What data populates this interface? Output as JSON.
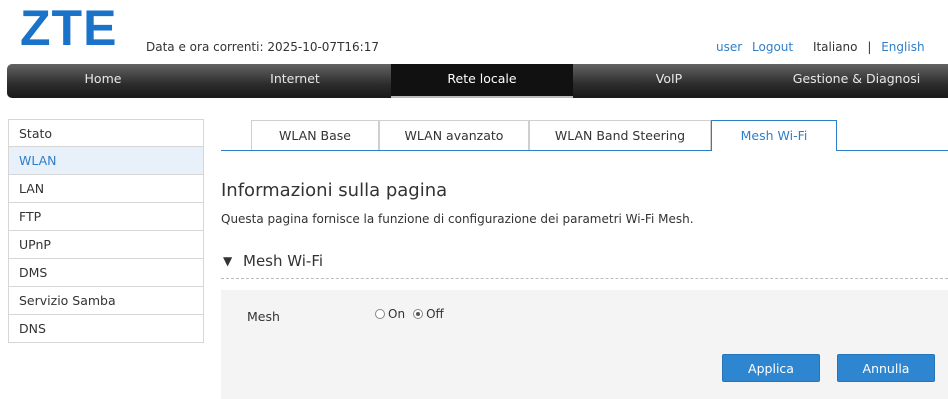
{
  "header": {
    "logo": "ZTE",
    "datetime": "Data e ora correnti: 2025-10-07T16:17",
    "user": "user",
    "logout": "Logout",
    "lang_it": "Italiano",
    "lang_sep": "|",
    "lang_en": "English"
  },
  "nav": {
    "items": [
      {
        "label": "Home",
        "active": false
      },
      {
        "label": "Internet",
        "active": false
      },
      {
        "label": "Rete locale",
        "active": true
      },
      {
        "label": "VoIP",
        "active": false
      },
      {
        "label": "Gestione & Diagnosi",
        "active": false
      }
    ]
  },
  "sidebar": {
    "items": [
      {
        "label": "Stato",
        "active": false
      },
      {
        "label": "WLAN",
        "active": true
      },
      {
        "label": "LAN",
        "active": false
      },
      {
        "label": "FTP",
        "active": false
      },
      {
        "label": "UPnP",
        "active": false
      },
      {
        "label": "DMS",
        "active": false
      },
      {
        "label": "Servizio Samba",
        "active": false
      },
      {
        "label": "DNS",
        "active": false
      }
    ]
  },
  "tabs": {
    "items": [
      {
        "label": "WLAN Base",
        "active": false
      },
      {
        "label": "WLAN avanzato",
        "active": false
      },
      {
        "label": "WLAN Band Steering",
        "active": false
      },
      {
        "label": "Mesh Wi-Fi",
        "active": true
      }
    ]
  },
  "main": {
    "title": "Informazioni sulla pagina",
    "description": "Questa pagina fornisce la funzione di configurazione dei parametri Wi-Fi Mesh.",
    "section_title": "Mesh Wi-Fi",
    "section_toggle": "▼",
    "mesh_label": "Mesh",
    "mesh_on": "On",
    "mesh_off": "Off",
    "mesh_value": "Off",
    "apply_label": "Applica",
    "cancel_label": "Annulla"
  },
  "colors": {
    "accent": "#2f7fc8",
    "button": "#2f86d0",
    "nav_dark": "#1a1a1a"
  }
}
